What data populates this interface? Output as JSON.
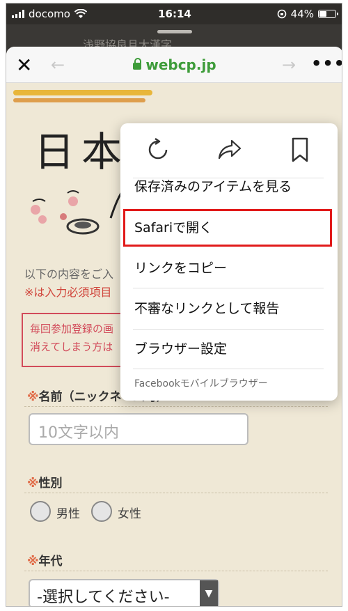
{
  "status_bar": {
    "carrier": "docomo",
    "time": "16:14",
    "battery": "44%",
    "battery_level": 0.44
  },
  "behind_page": {
    "partial_text": "浅野協良且大漢字"
  },
  "navbar": {
    "close_label": "✕",
    "back_label": "←",
    "forward_label": "→",
    "url": "webcp.jp",
    "more_label": "•••"
  },
  "page": {
    "logo_text": "日本",
    "intro_line1": "以下の内容をご入",
    "intro_line2": "※は入力必須項目",
    "notice_line1": "毎回参加登録の画",
    "notice_line2": "消えてしまう方は",
    "name_label_mark": "※",
    "name_label": "名前（ニックネーム可）",
    "name_placeholder": "10文字以内",
    "gender_label_mark": "※",
    "gender_label": "性別",
    "gender_options": [
      "男性",
      "女性"
    ],
    "age_label_mark": "※",
    "age_label": "年代",
    "age_select_value": "-選択してください-",
    "select_arrow": "▼"
  },
  "menu": {
    "icons": [
      "reload-icon",
      "share-icon",
      "bookmark-icon"
    ],
    "items": [
      "保存済みのアイテムを見る",
      "Safariで開く",
      "リンクをコピー",
      "不審なリンクとして報告",
      "ブラウザー設定"
    ],
    "footer": "Facebookモバイルブラウザー",
    "highlight_color": "#e11a1a"
  }
}
